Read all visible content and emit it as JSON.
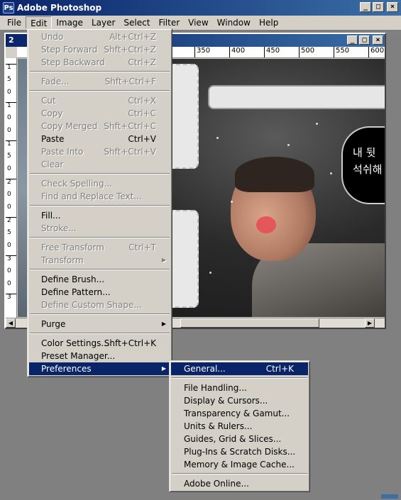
{
  "app": {
    "title": "Adobe Photoshop",
    "icon_label": "Ps"
  },
  "window_buttons": {
    "minimize": "_",
    "maximize": "□",
    "close": "×"
  },
  "menubar": [
    "File",
    "Edit",
    "Image",
    "Layer",
    "Select",
    "Filter",
    "View",
    "Window",
    "Help"
  ],
  "document": {
    "title": "2",
    "ruler_top": [
      "350",
      "400",
      "450",
      "500",
      "550",
      "600"
    ],
    "ruler_left": [
      "1",
      "5",
      "0",
      "1",
      "0",
      "0",
      "1",
      "5",
      "0",
      "2",
      "0",
      "0",
      "2",
      "5",
      "0",
      "3",
      "0",
      "0",
      "3"
    ],
    "bubble_text_line1": "내 뒷",
    "bubble_text_line2": "석쉬해"
  },
  "edit_menu": {
    "groups": [
      [
        {
          "label": "Undo",
          "shortcut": "Alt+Ctrl+Z",
          "enabled": false
        },
        {
          "label": "Step Forward",
          "shortcut": "Shft+Ctrl+Z",
          "enabled": false
        },
        {
          "label": "Step Backward",
          "shortcut": "Ctrl+Z",
          "enabled": false
        }
      ],
      [
        {
          "label": "Fade...",
          "shortcut": "Shft+Ctrl+F",
          "enabled": false
        }
      ],
      [
        {
          "label": "Cut",
          "shortcut": "Ctrl+X",
          "enabled": false
        },
        {
          "label": "Copy",
          "shortcut": "Ctrl+C",
          "enabled": false
        },
        {
          "label": "Copy Merged",
          "shortcut": "Shft+Ctrl+C",
          "enabled": false
        },
        {
          "label": "Paste",
          "shortcut": "Ctrl+V",
          "enabled": true
        },
        {
          "label": "Paste Into",
          "shortcut": "Shft+Ctrl+V",
          "enabled": false
        },
        {
          "label": "Clear",
          "shortcut": "",
          "enabled": false
        }
      ],
      [
        {
          "label": "Check Spelling...",
          "shortcut": "",
          "enabled": false
        },
        {
          "label": "Find and Replace Text...",
          "shortcut": "",
          "enabled": false
        }
      ],
      [
        {
          "label": "Fill...",
          "shortcut": "",
          "enabled": true
        },
        {
          "label": "Stroke...",
          "shortcut": "",
          "enabled": false
        }
      ],
      [
        {
          "label": "Free Transform",
          "shortcut": "Ctrl+T",
          "enabled": false
        },
        {
          "label": "Transform",
          "shortcut": "",
          "enabled": false,
          "submenu": true
        }
      ],
      [
        {
          "label": "Define Brush...",
          "shortcut": "",
          "enabled": true
        },
        {
          "label": "Define Pattern...",
          "shortcut": "",
          "enabled": true
        },
        {
          "label": "Define Custom Shape...",
          "shortcut": "",
          "enabled": false
        }
      ],
      [
        {
          "label": "Purge",
          "shortcut": "",
          "enabled": true,
          "submenu": true
        }
      ],
      [
        {
          "label": "Color Settings...",
          "shortcut": "Shft+Ctrl+K",
          "enabled": true
        },
        {
          "label": "Preset Manager...",
          "shortcut": "",
          "enabled": true
        },
        {
          "label": "Preferences",
          "shortcut": "",
          "enabled": true,
          "submenu": true,
          "selected": true
        }
      ]
    ]
  },
  "preferences_menu": {
    "groups": [
      [
        {
          "label": "General...",
          "shortcut": "Ctrl+K",
          "enabled": true,
          "selected": true
        }
      ],
      [
        {
          "label": "File Handling...",
          "shortcut": "",
          "enabled": true
        },
        {
          "label": "Display & Cursors...",
          "shortcut": "",
          "enabled": true
        },
        {
          "label": "Transparency & Gamut...",
          "shortcut": "",
          "enabled": true
        },
        {
          "label": "Units & Rulers...",
          "shortcut": "",
          "enabled": true
        },
        {
          "label": "Guides, Grid & Slices...",
          "shortcut": "",
          "enabled": true
        },
        {
          "label": "Plug-Ins & Scratch Disks...",
          "shortcut": "",
          "enabled": true
        },
        {
          "label": "Memory & Image Cache...",
          "shortcut": "",
          "enabled": true
        }
      ],
      [
        {
          "label": "Adobe Online...",
          "shortcut": "",
          "enabled": true
        }
      ]
    ]
  },
  "colors": {
    "title_active": "#0a246a",
    "title_gradient_end": "#3a6ea5",
    "menu_face": "#d4d0c8",
    "selection": "#0a246a",
    "workspace": "#808080",
    "disabled_text": "#808080"
  }
}
